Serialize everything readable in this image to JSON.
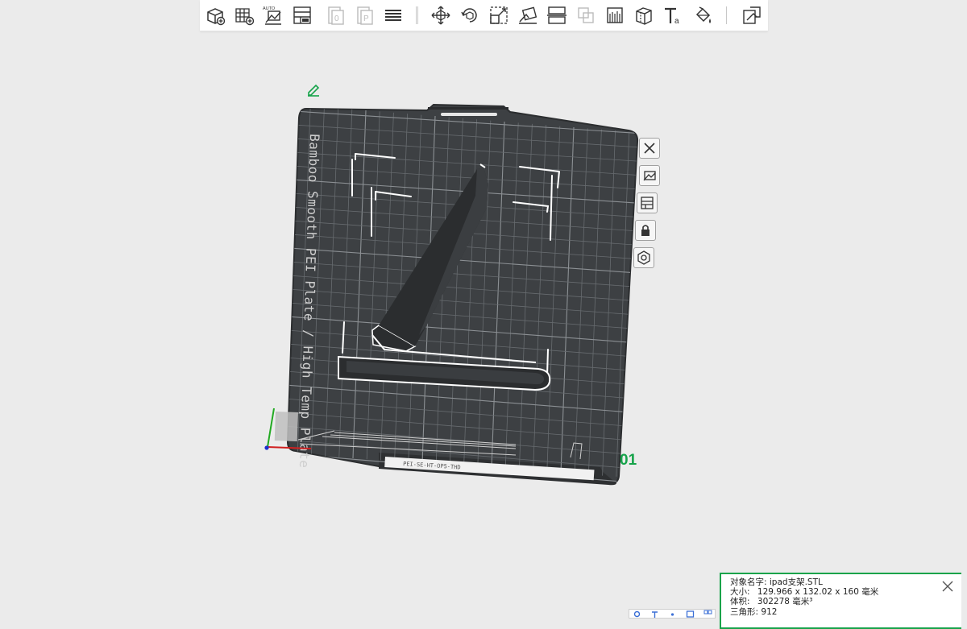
{
  "toolbar": {
    "tools": [
      {
        "name": "add-object-icon",
        "interactable": true
      },
      {
        "name": "add-plate-icon",
        "interactable": true
      },
      {
        "name": "auto-orient-icon",
        "interactable": true,
        "label": "AUTO"
      },
      {
        "name": "arrange-icon",
        "interactable": true
      },
      {
        "name": "sep"
      },
      {
        "name": "split-objects-icon",
        "interactable": false,
        "label": "0"
      },
      {
        "name": "split-parts-icon",
        "interactable": false,
        "label": "P"
      },
      {
        "name": "layers-icon",
        "interactable": true
      },
      {
        "name": "sep"
      },
      {
        "name": "move-icon",
        "interactable": true
      },
      {
        "name": "rotate-icon",
        "interactable": true
      },
      {
        "name": "scale-icon",
        "interactable": true
      },
      {
        "name": "lay-on-face-icon",
        "interactable": true
      },
      {
        "name": "cut-icon",
        "interactable": true
      },
      {
        "name": "boolean-icon",
        "interactable": false
      },
      {
        "name": "support-paint-icon",
        "interactable": true
      },
      {
        "name": "seam-paint-icon",
        "interactable": true
      },
      {
        "name": "text-emboss-icon",
        "interactable": true,
        "label": "a"
      },
      {
        "name": "color-paint-icon",
        "interactable": true
      },
      {
        "name": "sep"
      },
      {
        "name": "assembly-view-icon",
        "interactable": true
      }
    ]
  },
  "plate": {
    "label": "Bamboo Smooth PEI Plate / High Temp Plate",
    "index": "01",
    "bottom_code": "PEI-SE-HT-OP5-THD"
  },
  "side_tools": [
    {
      "name": "close-plate-icon"
    },
    {
      "name": "auto-orient-plate-icon"
    },
    {
      "name": "arrange-plate-icon"
    },
    {
      "name": "lock-plate-icon"
    },
    {
      "name": "plate-settings-icon"
    }
  ],
  "object_info": {
    "name_label": "对象名字:",
    "name_value": "ipad支架.STL",
    "size_label": "大小:",
    "size_value": "129.966 x 132.02 x 160 毫米",
    "volume_label": "体积:",
    "volume_value": "302278 毫米³",
    "triangles_label": "三角形:",
    "triangles_value": "912"
  },
  "colors": {
    "accent": "#16a34a",
    "plate": "#3d4043",
    "grid": "#6e7276",
    "model": "#2b2d2f",
    "background": "#ebebeb"
  }
}
